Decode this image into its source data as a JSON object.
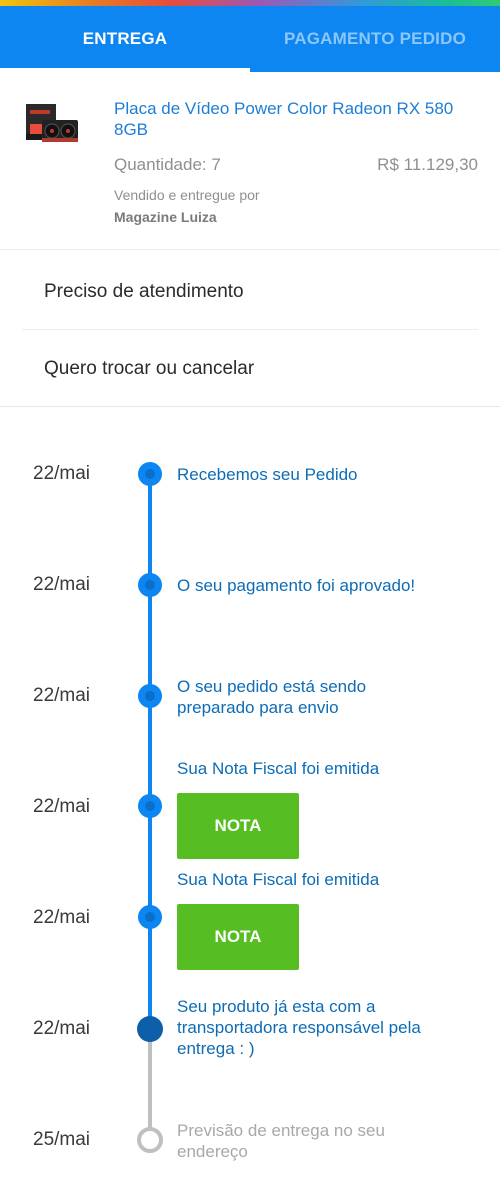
{
  "tabs": [
    {
      "label": "ENTREGA",
      "active": true
    },
    {
      "label": "PAGAMENTO PEDIDO",
      "active": false
    }
  ],
  "product": {
    "name": "Placa de Vídeo Power Color Radeon RX 580 8GB",
    "quantity": "Quantidade: 7",
    "price": "R$ 11.129,30",
    "seller_label": "Vendido e entregue por",
    "seller": "Magazine Luiza",
    "image_icon": "graphics-card-image"
  },
  "menu": {
    "support": "Preciso de atendimento",
    "exchange": "Quero trocar ou cancelar"
  },
  "timeline": [
    {
      "date": "22/mai",
      "text": "Recebemos seu Pedido",
      "state": "done"
    },
    {
      "date": "22/mai",
      "text": "O seu pagamento foi aprovado!",
      "state": "done"
    },
    {
      "date": "22/mai",
      "text": "O seu pedido está sendo preparado para envio",
      "state": "done"
    },
    {
      "date": "22/mai",
      "text": "Sua Nota Fiscal foi emitida",
      "button": "NOTA",
      "state": "done"
    },
    {
      "date": "22/mai",
      "text": "Sua Nota Fiscal foi emitida",
      "button": "NOTA",
      "state": "done"
    },
    {
      "date": "22/mai",
      "text": "Seu produto já esta com a transportadora responsável pela entrega : )",
      "state": "current"
    },
    {
      "date": "25/mai",
      "text": "Previsão de entrega no seu endereço",
      "state": "pending"
    }
  ],
  "colors": {
    "primary": "#0d86f2",
    "link": "#1e7ed6",
    "nota_button": "#56be22",
    "pending": "#c0c0c0"
  }
}
